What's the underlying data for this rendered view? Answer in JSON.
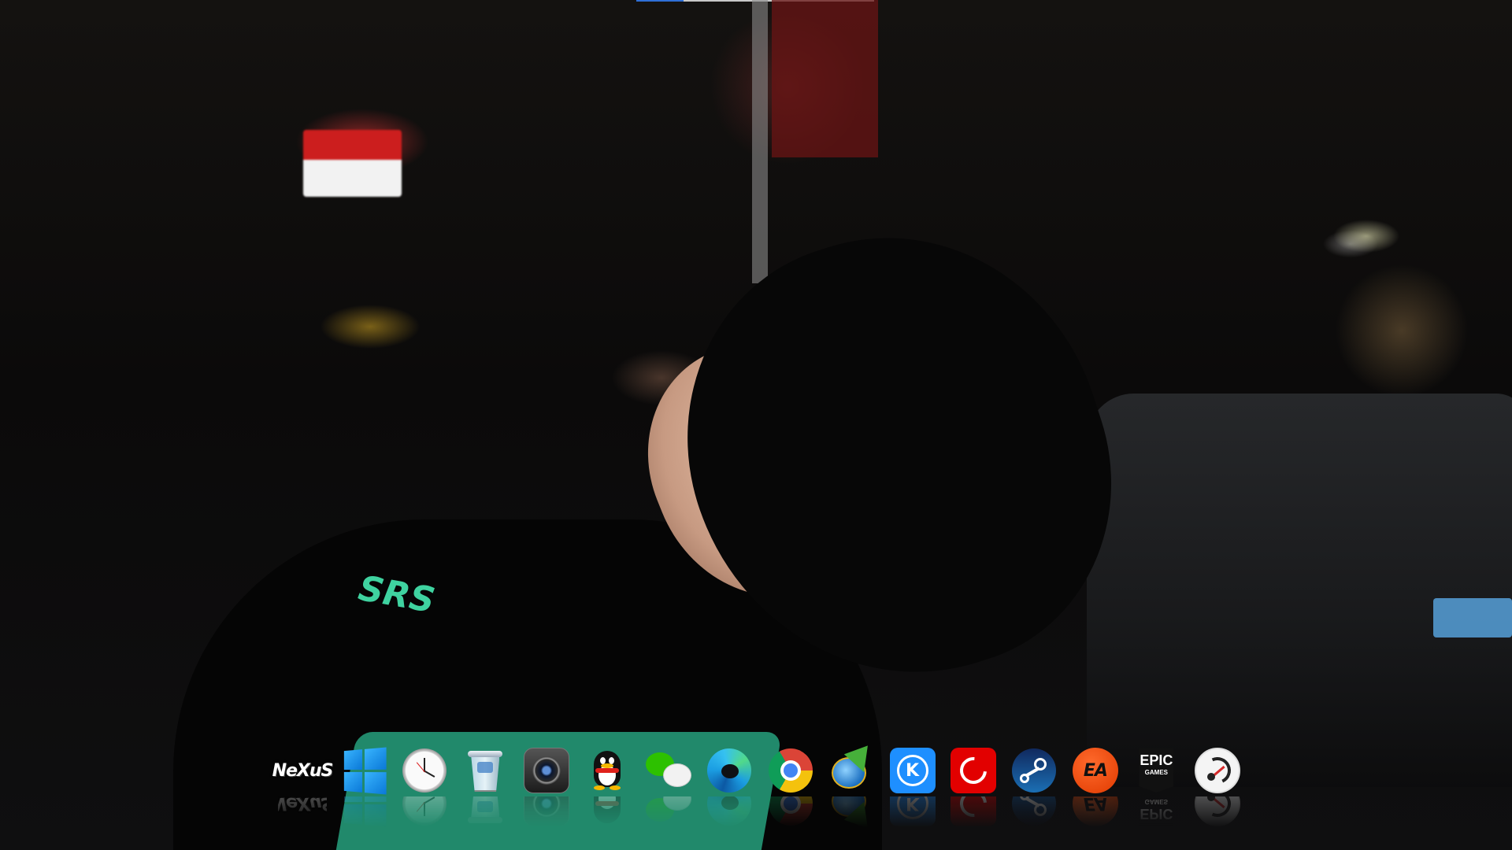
{
  "dock": {
    "items": [
      {
        "name": "nexus-dock-icon",
        "icon": "nexus-icon",
        "label": "NeXuS"
      },
      {
        "name": "windows-start-icon",
        "icon": "windows-logo-icon",
        "label": ""
      },
      {
        "name": "clock-icon",
        "icon": "analog-clock-icon",
        "label": ""
      },
      {
        "name": "recycle-bin-icon",
        "icon": "trash-can-icon",
        "label": ""
      },
      {
        "name": "camera-icon",
        "icon": "camera-lens-icon",
        "label": ""
      },
      {
        "name": "qq-icon",
        "icon": "qq-penguin-icon",
        "label": ""
      },
      {
        "name": "wechat-icon",
        "icon": "wechat-bubbles-icon",
        "label": ""
      },
      {
        "name": "edge-icon",
        "icon": "edge-browser-icon",
        "label": ""
      },
      {
        "name": "chrome-icon",
        "icon": "chrome-browser-icon",
        "label": ""
      },
      {
        "name": "idm-icon",
        "icon": "download-manager-icon",
        "label": ""
      },
      {
        "name": "kugou-icon",
        "icon": "kugou-music-icon",
        "label": "K"
      },
      {
        "name": "netease-music-icon",
        "icon": "netease-cloud-music-icon",
        "label": ""
      },
      {
        "name": "steam-icon",
        "icon": "steam-logo-icon",
        "label": ""
      },
      {
        "name": "ea-icon",
        "icon": "ea-logo-icon",
        "label": "EA"
      },
      {
        "name": "epic-games-icon",
        "icon": "epic-games-logo-icon",
        "label": "EPIC",
        "sublabel": "GAMES"
      },
      {
        "name": "speedometer-icon",
        "icon": "speed-gauge-icon",
        "label": ""
      }
    ]
  },
  "wallpaper": {
    "shirt_text": "SRS"
  },
  "colors": {
    "topbar": "#c8c8c8",
    "topbar_accent": "#2f6fd6"
  }
}
